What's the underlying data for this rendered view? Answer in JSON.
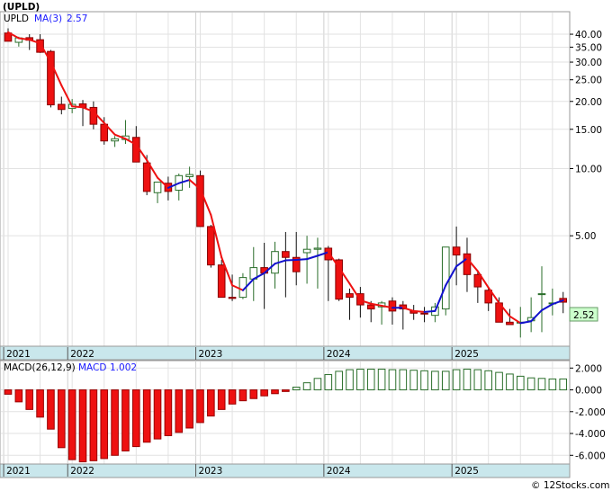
{
  "chart_data": [
    {
      "type": "candlestick",
      "title": "(UPLD)",
      "symbol_label": "UPLD",
      "indicator_label": "MA(3)",
      "indicator_value": "2.57",
      "last_price_label": "2.52",
      "scale": "log",
      "ylim": [
        1.6,
        50
      ],
      "yticks": [
        40,
        35,
        30,
        25,
        20,
        15,
        10,
        5
      ],
      "ytick_labels": [
        "40.00",
        "35.00",
        "30.00",
        "25.00",
        "20.00",
        "15.00",
        "10.00",
        "5.00"
      ],
      "year_labels": [
        "2021",
        "2022",
        "2023",
        "2024",
        "2025"
      ],
      "year_start_index": [
        0,
        6,
        18,
        30,
        42
      ],
      "months": [
        "2021-06",
        "2021-07",
        "2021-08",
        "2021-09",
        "2021-10",
        "2021-11",
        "2021-12",
        "2022-01",
        "2022-02",
        "2022-03",
        "2022-04",
        "2022-05",
        "2022-06",
        "2022-07",
        "2022-08",
        "2022-09",
        "2022-10",
        "2022-11",
        "2022-12",
        "2023-01",
        "2023-02",
        "2023-03",
        "2023-04",
        "2023-05",
        "2023-06",
        "2023-07",
        "2023-08",
        "2023-09",
        "2023-10",
        "2023-11",
        "2023-12",
        "2024-01",
        "2024-02",
        "2024-03",
        "2024-04",
        "2024-05",
        "2024-06",
        "2024-07",
        "2024-08",
        "2024-09",
        "2024-10",
        "2024-11",
        "2024-12",
        "2025-01",
        "2025-02",
        "2025-03",
        "2025-04",
        "2025-05",
        "2025-06",
        "2025-07",
        "2025-08",
        "2025-09",
        "2025-10"
      ],
      "open": [
        40.5,
        36.8,
        38.6,
        37.8,
        33.5,
        19.4,
        18.6,
        19.5,
        18.8,
        15.8,
        13.3,
        13.5,
        13.8,
        10.6,
        7.8,
        8.6,
        8.0,
        9.2,
        9.3,
        5.5,
        3.7,
        2.65,
        2.65,
        3.2,
        3.6,
        3.4,
        4.25,
        4.0,
        4.2,
        4.35,
        4.4,
        3.9,
        2.75,
        2.75,
        2.45,
        2.4,
        2.55,
        2.45,
        2.3,
        2.25,
        2.2,
        2.35,
        4.45,
        4.15,
        3.35,
        2.85,
        2.5,
        2.05,
        2.05,
        2.08,
        2.75,
        2.5,
        2.62
      ],
      "high": [
        42.5,
        39.0,
        40.0,
        40.0,
        34.0,
        21.0,
        20.5,
        20.3,
        20.0,
        17.0,
        14.0,
        16.5,
        15.5,
        11.5,
        8.6,
        9.2,
        9.5,
        10.2,
        9.8,
        5.6,
        3.9,
        3.35,
        3.4,
        4.45,
        4.65,
        4.7,
        5.2,
        5.2,
        5.0,
        4.9,
        4.5,
        3.95,
        2.9,
        2.95,
        2.55,
        2.55,
        2.65,
        2.55,
        2.45,
        2.4,
        2.5,
        4.45,
        5.5,
        4.9,
        3.5,
        2.95,
        2.65,
        2.35,
        2.4,
        2.65,
        3.65,
        2.9,
        2.8
      ],
      "low": [
        39.2,
        35.2,
        34.0,
        33.0,
        18.8,
        17.5,
        17.7,
        15.5,
        15.0,
        12.8,
        12.5,
        12.9,
        11.5,
        7.6,
        7.0,
        7.2,
        7.2,
        8.2,
        5.5,
        3.6,
        2.65,
        2.55,
        2.6,
        2.55,
        2.35,
        2.9,
        2.65,
        3.0,
        3.05,
        2.9,
        2.55,
        2.55,
        2.1,
        2.15,
        2.05,
        2.0,
        2.0,
        1.9,
        2.1,
        2.05,
        2.05,
        2.2,
        3.0,
        2.8,
        2.5,
        2.3,
        2.05,
        2.05,
        1.75,
        1.85,
        1.85,
        2.2,
        2.25
      ],
      "close": [
        37.2,
        38.5,
        37.6,
        33.2,
        19.3,
        18.4,
        19.4,
        18.8,
        15.8,
        13.3,
        13.6,
        14.0,
        10.7,
        7.9,
        8.7,
        7.9,
        9.3,
        9.4,
        5.5,
        3.7,
        2.65,
        2.62,
        3.25,
        3.6,
        3.4,
        4.25,
        4.0,
        3.45,
        4.35,
        4.4,
        3.9,
        2.6,
        2.65,
        2.45,
        2.35,
        2.5,
        2.3,
        2.35,
        2.25,
        2.23,
        2.4,
        4.45,
        4.1,
        3.35,
        2.95,
        2.5,
        2.05,
        2.0,
        2.05,
        2.15,
        2.75,
        2.5,
        2.52
      ],
      "ma": [
        40.8,
        38.4,
        37.8,
        36.4,
        30.0,
        23.6,
        19.0,
        18.8,
        18.0,
        16.0,
        14.2,
        13.6,
        12.8,
        10.9,
        9.1,
        8.2,
        8.6,
        8.9,
        8.1,
        6.2,
        4.0,
        3.0,
        2.85,
        3.2,
        3.4,
        3.75,
        3.88,
        3.9,
        3.93,
        4.07,
        4.22,
        3.6,
        3.05,
        2.57,
        2.48,
        2.43,
        2.38,
        2.38,
        2.3,
        2.28,
        2.3,
        3.0,
        3.65,
        3.96,
        3.47,
        2.93,
        2.5,
        2.18,
        2.03,
        2.07,
        2.32,
        2.47,
        2.57
      ]
    },
    {
      "type": "bar",
      "title": "MACD(26,12,9)",
      "indicator_label": "MACD",
      "indicator_value": "1.002",
      "ylim": [
        -6.8,
        2.6
      ],
      "yticks": [
        2,
        0,
        -2,
        -4,
        -6
      ],
      "ytick_labels": [
        "2.000",
        "0.000",
        "-2.000",
        "-4.000",
        "-6.000"
      ],
      "year_labels": [
        "2021",
        "2022",
        "2023",
        "2024",
        "2025"
      ],
      "values": [
        -0.4,
        -1.1,
        -1.8,
        -2.5,
        -3.6,
        -5.3,
        -6.4,
        -6.6,
        -6.5,
        -6.3,
        -6.0,
        -5.6,
        -5.2,
        -4.8,
        -4.5,
        -4.2,
        -3.9,
        -3.5,
        -3.0,
        -2.4,
        -1.8,
        -1.3,
        -1.0,
        -0.8,
        -0.55,
        -0.35,
        -0.15,
        0.25,
        0.65,
        1.05,
        1.4,
        1.7,
        1.85,
        1.9,
        1.9,
        1.9,
        1.85,
        1.85,
        1.8,
        1.75,
        1.7,
        1.7,
        1.85,
        1.9,
        1.85,
        1.75,
        1.6,
        1.45,
        1.25,
        1.1,
        1.05,
        1.0,
        1.0
      ]
    }
  ],
  "footer": {
    "copyright": "© 12Stocks.com"
  }
}
